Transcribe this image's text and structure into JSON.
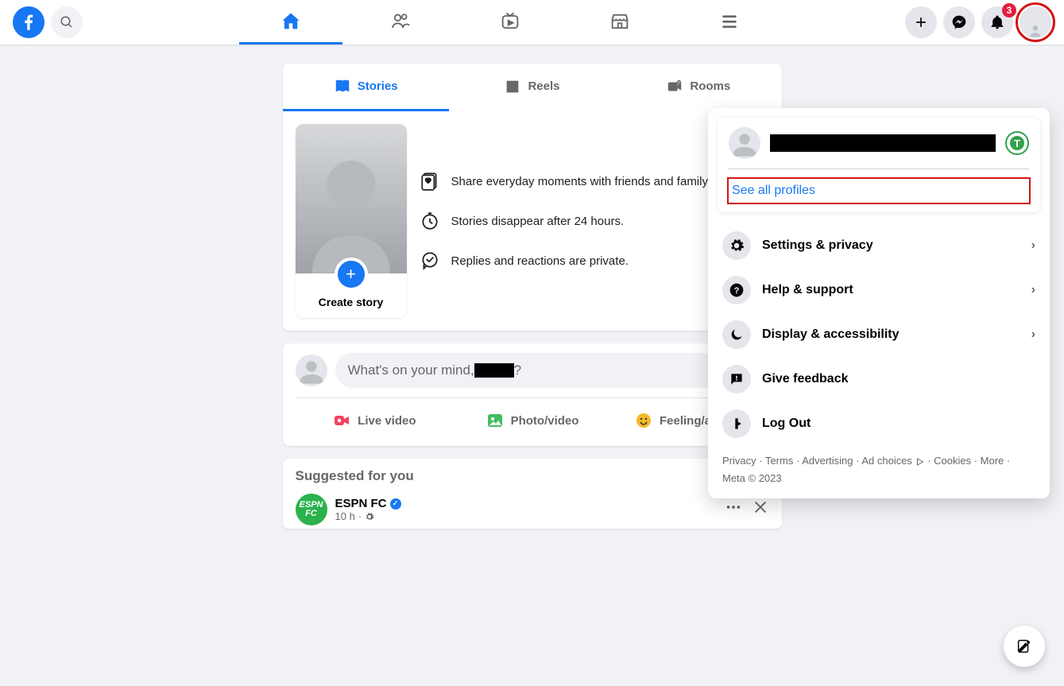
{
  "header": {
    "notification_count": "3"
  },
  "story_tabs": {
    "stories": "Stories",
    "reels": "Reels",
    "rooms": "Rooms"
  },
  "create_story": {
    "label": "Create story",
    "line1": "Share everyday moments with friends and family.",
    "line2": "Stories disappear after 24 hours.",
    "line3": "Replies and reactions are private."
  },
  "composer": {
    "placeholder_prefix": "What's on your mind, ",
    "placeholder_suffix": "?",
    "live_video": "Live video",
    "photo_video": "Photo/video",
    "feeling": "Feeling/activity"
  },
  "suggested": {
    "title": "Suggested for you",
    "post_name": "ESPN FC",
    "post_avatar_text": "ESPN FC",
    "post_time": "10 h"
  },
  "menu": {
    "see_all": "See all profiles",
    "settings": "Settings & privacy",
    "help": "Help & support",
    "display": "Display & accessibility",
    "feedback": "Give feedback",
    "logout": "Log Out",
    "switch_letter": "T"
  },
  "footer": {
    "privacy": "Privacy",
    "terms": "Terms",
    "advertising": "Advertising",
    "adchoices": "Ad choices",
    "cookies": "Cookies",
    "more": "More",
    "meta": "Meta © 2023"
  }
}
